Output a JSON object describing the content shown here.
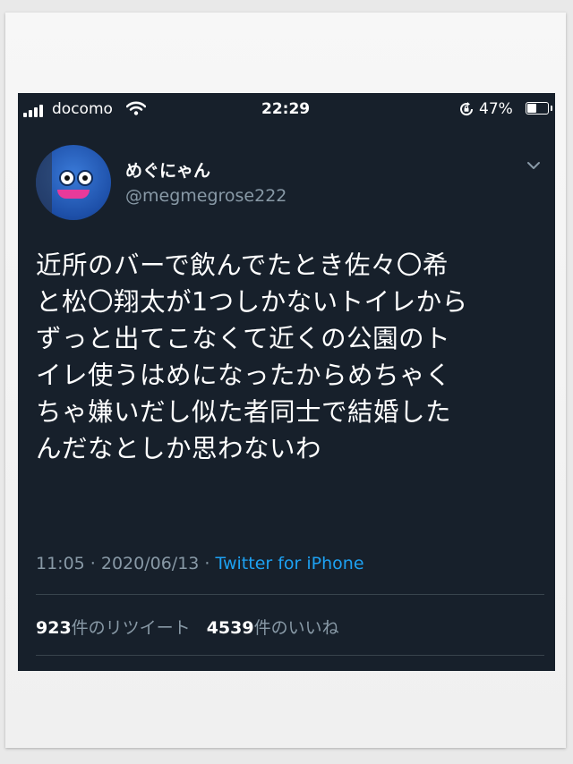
{
  "status_bar": {
    "carrier": "docomo",
    "time": "22:29",
    "battery_percent": "47%",
    "battery_level": 0.47
  },
  "tweet": {
    "display_name": "めぐにゃん",
    "handle": "@megmegrose222",
    "text_lines": [
      "近所のバーで飲んでたとき佐々〇希",
      "と松〇翔太が1つしかないトイレから",
      "ずっと出てこなくて近くの公園のト",
      "イレ使うはめになったからめちゃく",
      "ちゃ嫌いだし似た者同士で結婚した",
      "んだなとしか思わないわ"
    ],
    "timestamp": "11:05 · 2020/06/13 · ",
    "source": "Twitter for iPhone",
    "retweet_count": "923",
    "retweet_label": "件のリツイート",
    "like_count": "4539",
    "like_label": "件のいいね"
  },
  "icons": {
    "signal": "signal-bars-icon",
    "wifi": "wifi-icon",
    "rotation_lock": "rotation-lock-icon",
    "battery": "battery-icon",
    "menu": "chevron-down-icon"
  },
  "colors": {
    "background": "#17202b",
    "secondary_text": "#8899a6",
    "link": "#1da1f2",
    "divider": "#38444d"
  }
}
